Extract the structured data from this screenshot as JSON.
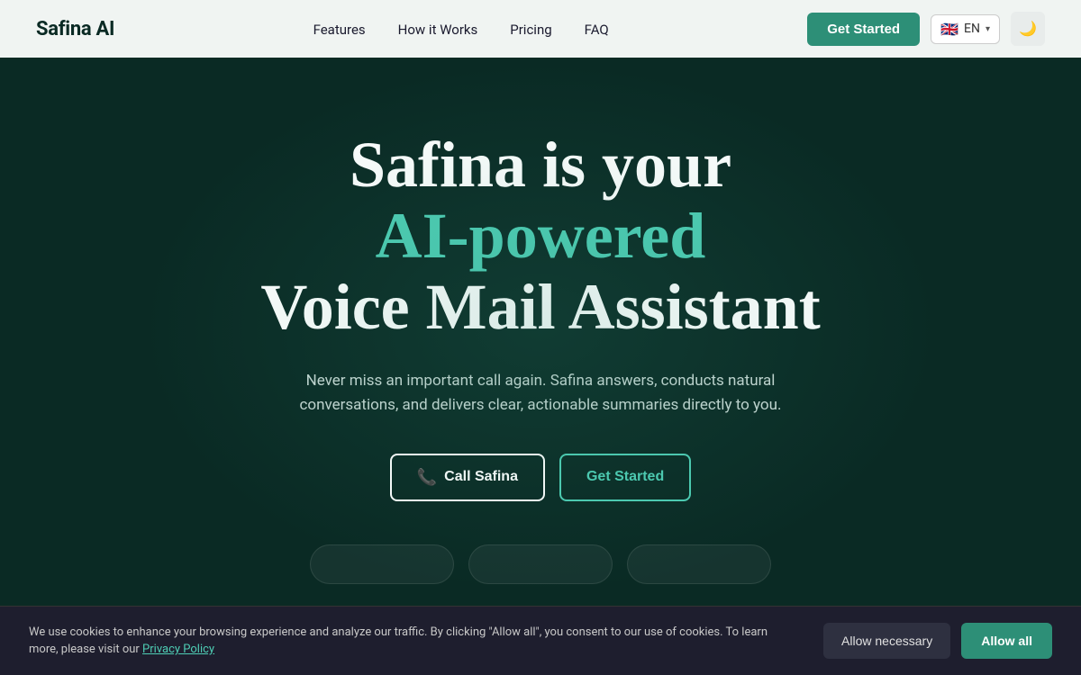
{
  "navbar": {
    "logo": "Safina AI",
    "nav_items": [
      {
        "label": "Features",
        "href": "#"
      },
      {
        "label": "How it Works",
        "href": "#"
      },
      {
        "label": "Pricing",
        "href": "#"
      },
      {
        "label": "FAQ",
        "href": "#"
      }
    ],
    "get_started_label": "Get Started",
    "lang_code": "EN",
    "flag_emoji": "🇬🇧",
    "theme_toggle_icon": "🌙"
  },
  "hero": {
    "title_line1": "Safina is your",
    "title_line2": "AI-powered",
    "title_line3": "Voice Mail Assistant",
    "subtitle": "Never miss an important call again. Safina answers, conducts natural conversations, and delivers clear, actionable summaries directly to you.",
    "btn_call_label": "Call Safina",
    "btn_get_started_label": "Get Started",
    "pills": [
      "",
      "",
      ""
    ]
  },
  "cookie_banner": {
    "text": "We use cookies to enhance your browsing experience and analyze our traffic. By clicking \"Allow all\", you consent to our use of cookies. To learn more, please visit our ",
    "privacy_link_text": "Privacy Policy",
    "allow_necessary_label": "Allow necessary",
    "allow_all_label": "Allow all"
  }
}
